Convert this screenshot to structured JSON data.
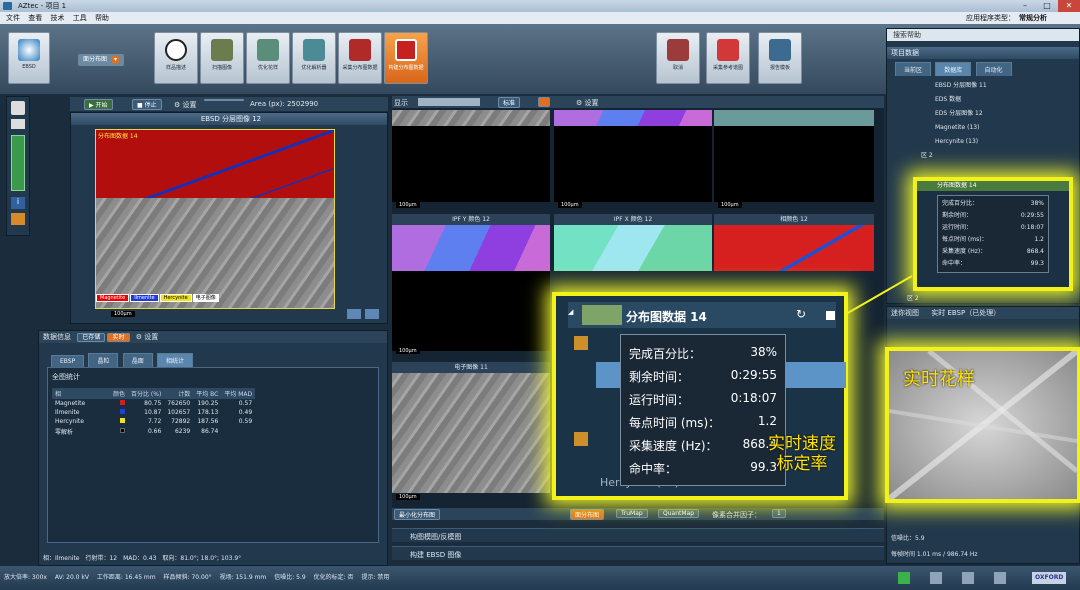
{
  "window": {
    "title": "AZtec - 项目 1",
    "app_type_label": "应用程序类型：",
    "app_type_value": "常规分析"
  },
  "menu": [
    "文件",
    "查看",
    "技术",
    "工具",
    "帮助"
  ],
  "toolbar": {
    "ebsd": "EBSD",
    "mode": "面分布图",
    "steps": [
      "样品描述",
      "扫描图像",
      "优化花样",
      "优化解析器",
      "采集分布图数据",
      "构建分布图数据"
    ],
    "right": [
      "取消",
      "采集参考谱图",
      "报告模板"
    ]
  },
  "controls": {
    "start": "开始",
    "stop": "停止",
    "settings": "设置",
    "area_label": "Area (px): 2502990"
  },
  "left_image": {
    "title": "EBSD 分层图像 12",
    "dataset": "分布图数据 14",
    "scale": "100μm",
    "legend": [
      "Magnetite",
      "Ilmenite",
      "Hercynite",
      "电子图像"
    ]
  },
  "data_info": {
    "header": "数据信息",
    "stored": "已存储",
    "realtime": "实时",
    "settings": "设置",
    "tabs": [
      "EBSP",
      "晶粒",
      "晶面",
      "相统计"
    ],
    "section": "全图统计",
    "cols": [
      "相",
      "颜色",
      "百分比 (%)",
      "计数",
      "平均 BC",
      "平均 MAD"
    ],
    "rows": [
      {
        "name": "Magnetite",
        "color": "#d02020",
        "pct": "80.75",
        "count": "762650",
        "bc": "190.25",
        "mad": "0.57"
      },
      {
        "name": "Ilmenite",
        "color": "#2040d0",
        "pct": "10.87",
        "count": "102657",
        "bc": "178.13",
        "mad": "0.49"
      },
      {
        "name": "Hercynite",
        "color": "#f0e020",
        "pct": "7.72",
        "count": "72892",
        "bc": "187.56",
        "mad": "0.59"
      },
      {
        "name": "零解析",
        "color": "#000000",
        "pct": "0.66",
        "count": "6239",
        "bc": "86.74",
        "mad": ""
      }
    ],
    "footer": "相：Ilmenite　行射带：12　MAD：0.43　取向：81.0°; 18.0°; 103.9°"
  },
  "center": {
    "display": "显示",
    "standard": "标准",
    "settings": "设置",
    "tiles": [
      {
        "title": "IPF Y 颜色 12"
      },
      {
        "title": "IPF X 颜色 12"
      },
      {
        "title": "相颜色 12"
      }
    ],
    "electron": "电子图像 11",
    "scale": "100μm",
    "mini_label": "最小化分布图",
    "mini_tabs": [
      "面分布图",
      "TruMap",
      "QuantMap"
    ],
    "bin_label": "像素合并因子：",
    "bin_value": "1",
    "collapsed": [
      "构图模图/反模图",
      "构建 EBSD 图像"
    ]
  },
  "project": {
    "search": "搜索帮助",
    "header": "项目数据",
    "tabs": [
      "当前区",
      "数据库",
      "自动化"
    ],
    "tree": [
      "EBSD 分层图像 11",
      "EDS 数据",
      "EDS 分层图像 12",
      "Magnetite (13)",
      "Hercynite (13)",
      "区 2",
      "电子图像 14",
      "分布图数据 14",
      "区 2"
    ],
    "small_stats": [
      [
        "完成百分比：",
        "38%"
      ],
      [
        "剩余时间：",
        "0:29:55"
      ],
      [
        "运行时间：",
        "0:18:07"
      ],
      [
        "每点时间 (ms)：",
        "1.2"
      ],
      [
        "采集速度 (Hz)：",
        "868.4"
      ],
      [
        "命中率：",
        "99.3"
      ]
    ]
  },
  "callout": {
    "title": "分布图数据 14",
    "stats": [
      [
        "完成百分比：",
        "38%"
      ],
      [
        "剩余时间：",
        "0:29:55"
      ],
      [
        "运行时间：",
        "0:18:07"
      ],
      [
        "每点时间 (ms)：",
        "1.2"
      ],
      [
        "采集速度 (Hz)：",
        "868.4"
      ],
      [
        "命中率：",
        "99.3"
      ]
    ],
    "tree_tail": "Hercynite (14)",
    "annotation": "实时速度\n标定率"
  },
  "mini": {
    "header": "迷你视图",
    "mode": "实时 EBSP（已处理）",
    "annotation": "实时花样",
    "noise": "信噪比：5.9",
    "time": "每帧时间 1.01 ms / 986.74 Hz"
  },
  "status": [
    "放大倍率: 300x",
    "AV: 20.0 kV",
    "工作距离: 16.45 mm",
    "样品倾斜: 70.00°",
    "视场: 151.9 mm",
    "信噪比: 5.9",
    "优化的标定: 否",
    "提示: 禁用"
  ],
  "logo": "OXFORD"
}
